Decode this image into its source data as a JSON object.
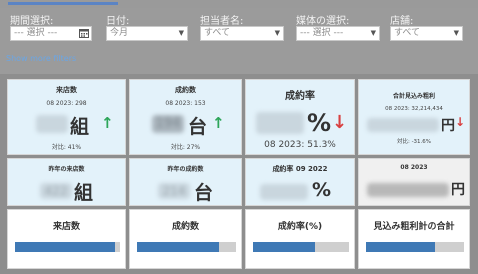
{
  "filters": {
    "period": {
      "label": "期間選択:",
      "value": "--- 選択 ---"
    },
    "date": {
      "label": "日付:",
      "value": "今月"
    },
    "staff": {
      "label": "担当者名:",
      "value": "すべて"
    },
    "media": {
      "label": "媒体の選択:",
      "value": "--- 選択 ---"
    },
    "store": {
      "label": "店舗:",
      "value": "すべて"
    },
    "show_more": "Show more filters"
  },
  "kpi_row1": {
    "visits": {
      "title": "来店数",
      "sub": "08 2023: 298",
      "unit": "組",
      "foot": "対比: 41%",
      "trend": "↑"
    },
    "contracts": {
      "title": "成約数",
      "sub": "08 2023: 153",
      "value": "194",
      "unit": "台",
      "foot": "対比: 27%",
      "trend": "↑"
    },
    "rate": {
      "title": "成約率",
      "unit": "%",
      "foot": "08 2023: 51.3%",
      "trend": "↓"
    },
    "profit": {
      "title": "合計見込み粗利",
      "sub": "08 2023: 32,214,434",
      "unit": "円",
      "foot": "対比: -31.6%",
      "trend": "↓"
    }
  },
  "kpi_row2": {
    "visits_ly": {
      "title": "昨年の来店数",
      "value": "422",
      "unit": "組"
    },
    "contracts_ly": {
      "title": "昨年の成約数",
      "value": "214",
      "unit": "台"
    },
    "rate_ly": {
      "title": "成約率 09 2022",
      "unit": "%"
    },
    "profit_prev": {
      "title": "08 2023",
      "unit": "円"
    }
  },
  "bars": [
    {
      "label": "来店数",
      "progress": 0.95
    },
    {
      "label": "成約数",
      "progress": 0.83
    },
    {
      "label": "成約率(%)",
      "progress": 0.65
    },
    {
      "label": "見込み粗利計の合計",
      "progress": 0.7
    }
  ],
  "colors": {
    "accent": "#5b84c4",
    "up": "#2ea65a",
    "down": "#d84040",
    "bar_fill": "#3f79b5",
    "card_blue": "#e3f2fa"
  }
}
